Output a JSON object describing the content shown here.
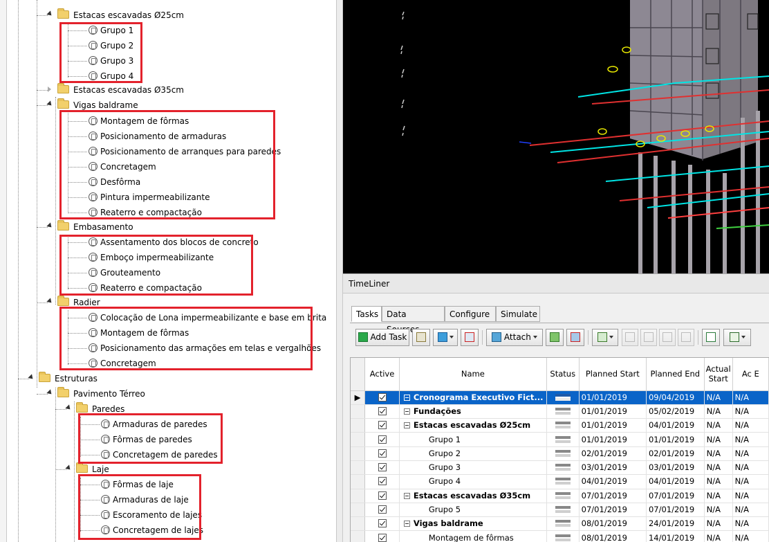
{
  "tree": {
    "nodes": [
      {
        "id": "estacas25",
        "label": "Estacas escavadas Ø25cm",
        "type": "folder",
        "expanded": true
      },
      {
        "id": "g1",
        "label": "Grupo 1",
        "type": "task"
      },
      {
        "id": "g2",
        "label": "Grupo 2",
        "type": "task"
      },
      {
        "id": "g3",
        "label": "Grupo 3",
        "type": "task"
      },
      {
        "id": "g4",
        "label": "Grupo 4",
        "type": "task"
      },
      {
        "id": "estacas35",
        "label": "Estacas escavadas Ø35cm",
        "type": "folder",
        "expanded": false
      },
      {
        "id": "vigas",
        "label": "Vigas baldrame",
        "type": "folder",
        "expanded": true
      },
      {
        "id": "v1",
        "label": "Montagem de fôrmas",
        "type": "task"
      },
      {
        "id": "v2",
        "label": "Posicionamento de armaduras",
        "type": "task"
      },
      {
        "id": "v3",
        "label": "Posicionamento de arranques para paredes",
        "type": "task"
      },
      {
        "id": "v4",
        "label": "Concretagem",
        "type": "task"
      },
      {
        "id": "v5",
        "label": "Desfôrma",
        "type": "task"
      },
      {
        "id": "v6",
        "label": "Pintura impermeabilizante",
        "type": "task"
      },
      {
        "id": "v7",
        "label": "Reaterro e compactação",
        "type": "task"
      },
      {
        "id": "embas",
        "label": "Embasamento",
        "type": "folder",
        "expanded": true
      },
      {
        "id": "e1",
        "label": "Assentamento dos blocos de concreto",
        "type": "task"
      },
      {
        "id": "e2",
        "label": "Emboço impermeabilizante",
        "type": "task"
      },
      {
        "id": "e3",
        "label": "Grouteamento",
        "type": "task"
      },
      {
        "id": "e4",
        "label": "Reaterro e compactação",
        "type": "task"
      },
      {
        "id": "radier",
        "label": "Radier",
        "type": "folder",
        "expanded": true
      },
      {
        "id": "r1",
        "label": "Colocação de Lona impermeabilizante e base em brita",
        "type": "task"
      },
      {
        "id": "r2",
        "label": "Montagem de fôrmas",
        "type": "task"
      },
      {
        "id": "r3",
        "label": "Posicionamento das armações em telas e vergalhões",
        "type": "task"
      },
      {
        "id": "r4",
        "label": "Concretagem",
        "type": "task"
      },
      {
        "id": "estrut",
        "label": "Estruturas",
        "type": "folder",
        "expanded": true
      },
      {
        "id": "pav",
        "label": "Pavimento Térreo",
        "type": "folder",
        "expanded": true
      },
      {
        "id": "paredes",
        "label": "Paredes",
        "type": "folder",
        "expanded": true
      },
      {
        "id": "p1",
        "label": "Armaduras de paredes",
        "type": "task"
      },
      {
        "id": "p2",
        "label": "Fôrmas de paredes",
        "type": "task"
      },
      {
        "id": "p3",
        "label": "Concretagem de paredes",
        "type": "task"
      },
      {
        "id": "laje",
        "label": "Laje",
        "type": "folder",
        "expanded": true
      },
      {
        "id": "l1",
        "label": "Fôrmas de laje",
        "type": "task"
      },
      {
        "id": "l2",
        "label": "Armaduras de laje",
        "type": "task"
      },
      {
        "id": "l3",
        "label": "Escoramento de lajes",
        "type": "task"
      },
      {
        "id": "l4",
        "label": "Concretagem de lajes",
        "type": "task"
      }
    ]
  },
  "timeliner": {
    "title": "TimeLiner",
    "tabs": [
      "Tasks",
      "Data Sources",
      "Configure",
      "Simulate"
    ],
    "active_tab": "Tasks",
    "toolbar": {
      "add_task": "Add Task",
      "attach": "Attach"
    },
    "columns": [
      "Active",
      "Name",
      "Status",
      "Planned Start",
      "Planned End",
      "Actual Start",
      "Ac E"
    ],
    "rows": [
      {
        "name": "Cronograma Executivo Fict...",
        "level": 0,
        "group": true,
        "start": "01/01/2019",
        "end": "09/04/2019",
        "actual": "N/A",
        "actual_end": "N/A",
        "selected": true
      },
      {
        "name": "Fundações",
        "level": 0,
        "group": true,
        "start": "01/01/2019",
        "end": "05/02/2019",
        "actual": "N/A",
        "actual_end": "N/A"
      },
      {
        "name": "Estacas escavadas Ø25cm",
        "level": 0,
        "group": true,
        "start": "01/01/2019",
        "end": "04/01/2019",
        "actual": "N/A",
        "actual_end": "N/A"
      },
      {
        "name": "Grupo 1",
        "level": 1,
        "group": false,
        "start": "01/01/2019",
        "end": "01/01/2019",
        "actual": "N/A",
        "actual_end": "N/A"
      },
      {
        "name": "Grupo 2",
        "level": 1,
        "group": false,
        "start": "02/01/2019",
        "end": "02/01/2019",
        "actual": "N/A",
        "actual_end": "N/A"
      },
      {
        "name": "Grupo 3",
        "level": 1,
        "group": false,
        "start": "03/01/2019",
        "end": "03/01/2019",
        "actual": "N/A",
        "actual_end": "N/A"
      },
      {
        "name": "Grupo 4",
        "level": 1,
        "group": false,
        "start": "04/01/2019",
        "end": "04/01/2019",
        "actual": "N/A",
        "actual_end": "N/A"
      },
      {
        "name": "Estacas escavadas Ø35cm",
        "level": 0,
        "group": true,
        "start": "07/01/2019",
        "end": "07/01/2019",
        "actual": "N/A",
        "actual_end": "N/A"
      },
      {
        "name": "Grupo 5",
        "level": 1,
        "group": false,
        "start": "07/01/2019",
        "end": "07/01/2019",
        "actual": "N/A",
        "actual_end": "N/A"
      },
      {
        "name": "Vigas baldrame",
        "level": 0,
        "group": true,
        "start": "08/01/2019",
        "end": "24/01/2019",
        "actual": "N/A",
        "actual_end": "N/A"
      },
      {
        "name": "Montagem de fôrmas",
        "level": 1,
        "group": false,
        "start": "08/01/2019",
        "end": "14/01/2019",
        "actual": "N/A",
        "actual_end": "N/A"
      }
    ]
  },
  "colors": {
    "highlight": "#e3222c",
    "selection": "#0a64c8",
    "viewport_bg": "#000000"
  }
}
